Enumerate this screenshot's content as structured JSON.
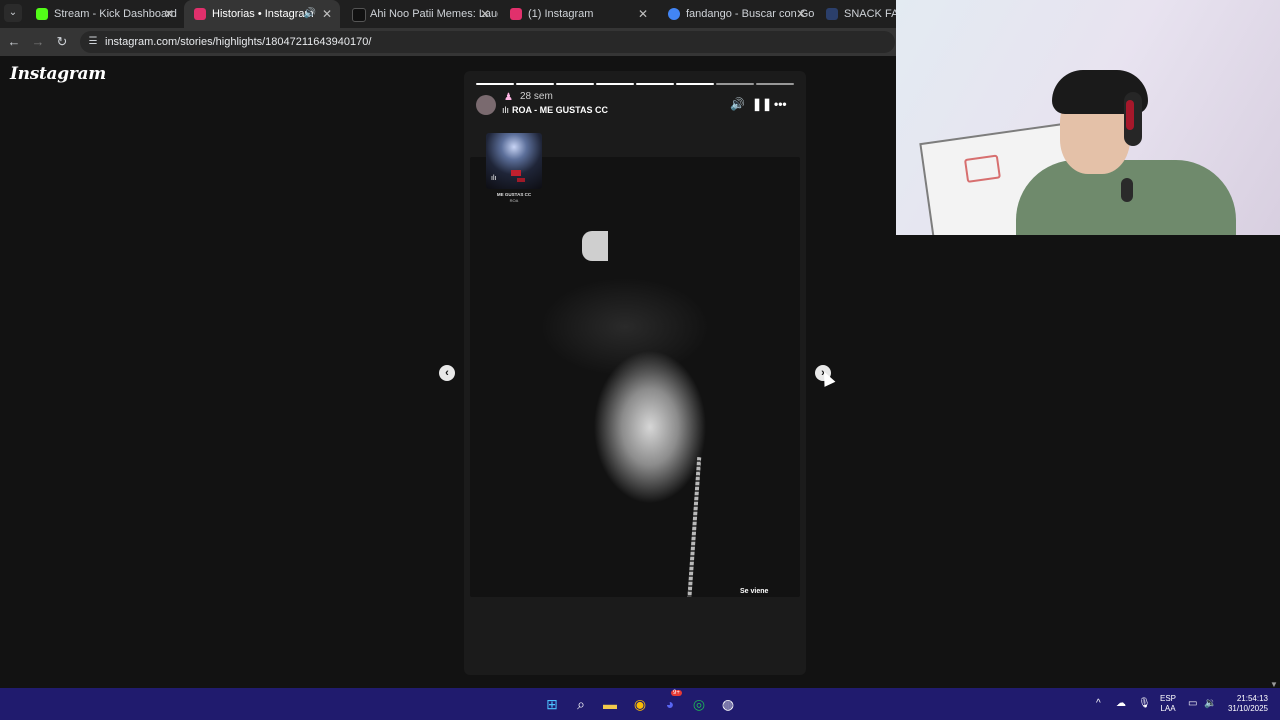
{
  "browser": {
    "tabs": [
      {
        "label": "Stream - Kick Dashboard",
        "favicon_color": "#53fc18",
        "active": false
      },
      {
        "label": "Historias • Instagram",
        "favicon_color": "#e1306c",
        "active": true,
        "audio": true
      },
      {
        "label": "Ahi Noo Patii Memes: Laugh O",
        "favicon_color": "#111111",
        "active": false
      },
      {
        "label": "(1) Instagram",
        "favicon_color": "#e1306c",
        "active": false
      },
      {
        "label": "fandango - Buscar con Google",
        "favicon_color": "#4285f4",
        "active": false
      },
      {
        "label": "SNACK FANDANGO",
        "favicon_color": "#2b3f6b",
        "active": false
      }
    ],
    "url": "instagram.com/stories/highlights/18047211643940170/"
  },
  "instagram": {
    "logo": "Instagram",
    "story": {
      "time_ago": "28 sem",
      "music": "ROA - ME GUSTAS CC",
      "sticker_title": "ME GUSTAS CC",
      "sticker_artist": "ROA",
      "caption": "Se viene",
      "segments_total": 8,
      "segments_done": 6
    }
  },
  "taskbar": {
    "lang_top": "ESP",
    "lang_bottom": "LAA",
    "time": "21:54:13",
    "date": "31/10/2025",
    "discord_badge": "9+"
  },
  "colors": {
    "taskbar": "#201b6e",
    "page_bg": "#121212"
  }
}
